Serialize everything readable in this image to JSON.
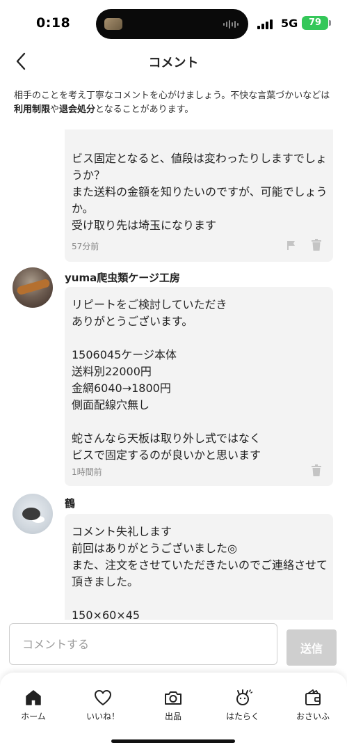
{
  "status_bar": {
    "time": "0:18",
    "network": "5G",
    "battery": "79"
  },
  "header": {
    "title": "コメント",
    "back_icon": "chevron-left-icon"
  },
  "notice": {
    "part1": "相手のことを考え丁寧なコメントを心がけましょう。不快な言葉づかいなどは",
    "bold1": "利用制限",
    "part2": "や",
    "bold2": "退会処分",
    "part3": "となることがあります。"
  },
  "comments": [
    {
      "author": "",
      "text": "ビス固定となると、値段は変わったりしますでしょうか？\nまた送料の金額を知りたいのですが、可能でしょうか。\n受け取り先は埼玉になります",
      "time": "57分前",
      "icons": [
        "flag-icon",
        "trash-icon"
      ]
    },
    {
      "author": "yuma爬虫類ケージ工房",
      "text": "リピートをご検討していただき\nありがとうございます。\n\n1506045ケージ本体\n送料別22000円\n金網6040→1800円\n側面配線穴無し\n\n蛇さんなら天板は取り外し式ではなく\nビスで固定するのが良いかと思います",
      "time": "1時間前",
      "icons": [
        "trash-icon"
      ]
    },
    {
      "author": "鶴",
      "text": "コメント失礼します\n前回はありがとうございました◎\nまた、注文をさせていただきたいのでご連絡させて頂きました。\n\n150×60×45",
      "time": "",
      "icons": []
    }
  ],
  "input": {
    "placeholder": "コメントする",
    "value": "",
    "send_label": "送信"
  },
  "tab_bar": [
    {
      "label": "ホーム",
      "icon": "home-icon"
    },
    {
      "label": "いいね！",
      "icon": "heart-icon"
    },
    {
      "label": "出品",
      "icon": "camera-icon"
    },
    {
      "label": "はたらく",
      "icon": "work-icon"
    },
    {
      "label": "おさいふ",
      "icon": "wallet-icon"
    }
  ]
}
